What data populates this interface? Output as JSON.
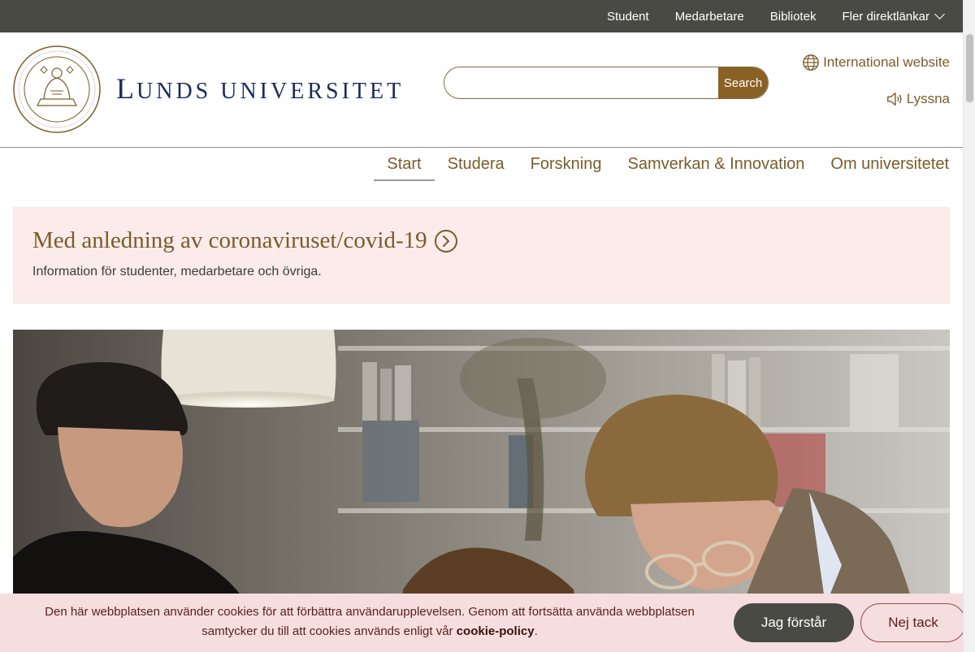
{
  "topbar": {
    "links": [
      "Student",
      "Medarbetare",
      "Bibliotek"
    ],
    "more_label": "Fler direktlänkar"
  },
  "brand": {
    "wordmark_first": "L",
    "wordmark_rest": "UNDS UNIVERSITET"
  },
  "search": {
    "placeholder": "",
    "value": "",
    "button_label": "Search"
  },
  "header": {
    "international_label": "International website",
    "listen_label": "Lyssna"
  },
  "nav": {
    "items": [
      {
        "label": "Start",
        "active": true
      },
      {
        "label": "Studera",
        "active": false
      },
      {
        "label": "Forskning",
        "active": false
      },
      {
        "label": "Samverkan & Innovation",
        "active": false
      },
      {
        "label": "Om universitetet",
        "active": false
      }
    ]
  },
  "covid_banner": {
    "title": "Med anledning av coronaviruset/covid-19",
    "description": "Information för studenter, medarbetare och övriga."
  },
  "cookie_bar": {
    "text_before": "Den här webbplatsen använder cookies för att förbättra användarupplevelsen. Genom att fortsätta använda webbplatsen samtycker du till att cookies används enligt vår ",
    "policy_link": "cookie-policy",
    "text_after": ".",
    "accept_label": "Jag förstår",
    "decline_label": "Nej tack"
  },
  "colors": {
    "topbar_bg": "#4a4a45",
    "brand_navy": "#1c2a5c",
    "bronze": "#7a5c2a",
    "search_button": "#8a6124",
    "covid_bg": "#fbebeb",
    "cookie_bg": "#f6dede"
  },
  "icons": {
    "more_links": "chevron-down-icon",
    "international": "globe-icon",
    "listen": "speaker-icon",
    "covid_arrow": "circle-arrow-right-icon"
  }
}
